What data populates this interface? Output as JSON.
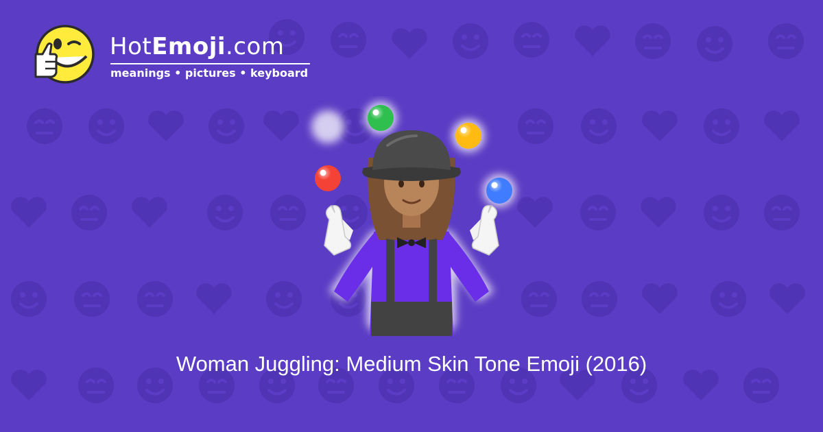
{
  "colors": {
    "background": "#5b3cc4",
    "pattern": "#5034b6",
    "text": "#ffffff",
    "shirt": "#6b2ee8",
    "skin": "#b8845a",
    "hair": "#7a5233",
    "hat": "#4a4a4a",
    "ball_red": "#f44336",
    "ball_green": "#2fbf4f",
    "ball_yellow": "#ffbb11",
    "ball_blue": "#3f7cff"
  },
  "logo": {
    "brand_plain": "Hot",
    "brand_bold": "Emoji",
    "brand_suffix": ".com",
    "tagline": "meanings • pictures • keyboard",
    "mascot_icon": "thumbs-up-winking-face-icon"
  },
  "emoji": {
    "title": "Woman Juggling: Medium Skin Tone Emoji (2016)",
    "image_icon": "woman-juggling-medium-skin-tone-icon"
  }
}
